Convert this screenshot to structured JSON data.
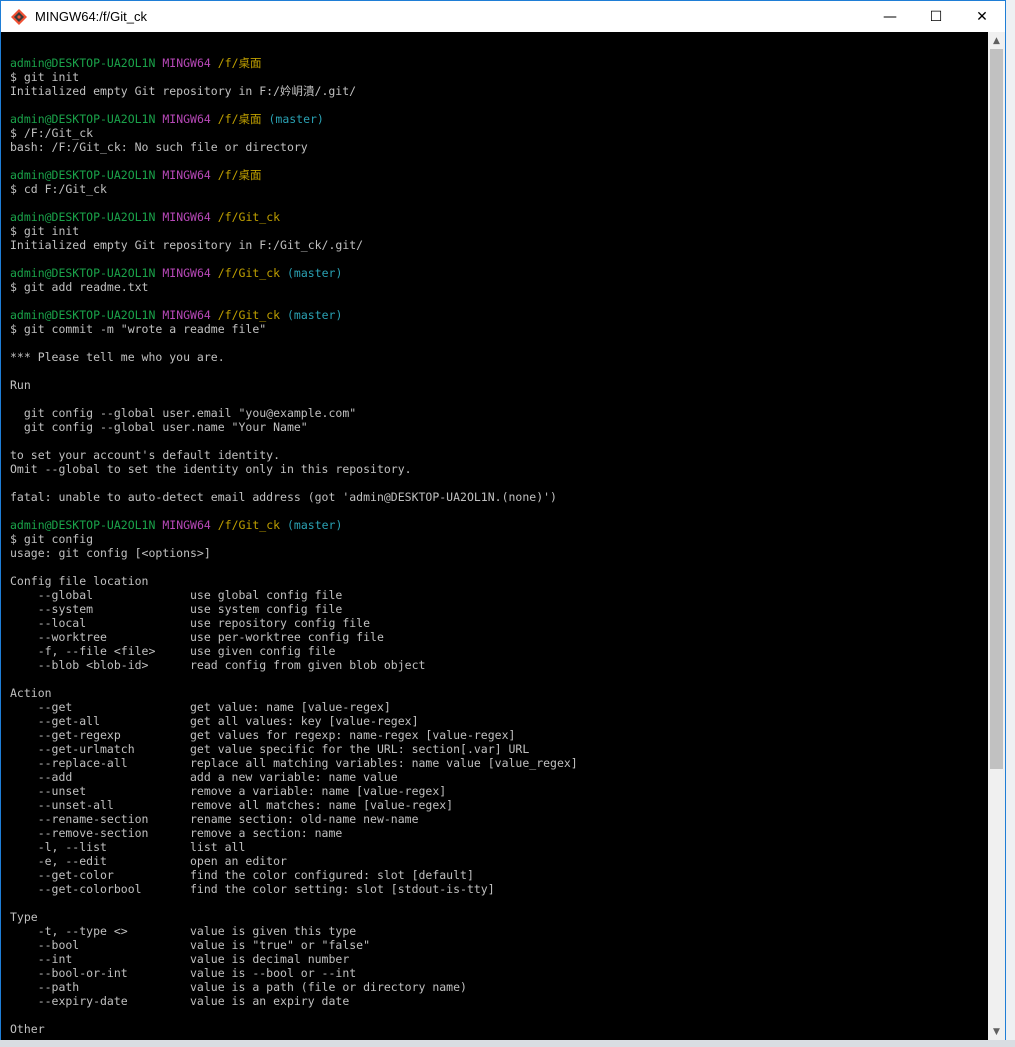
{
  "window": {
    "title": "MINGW64:/f/Git_ck",
    "buttons": {
      "minimize": "—",
      "maximize": "☐",
      "close": "✕"
    }
  },
  "colors": {
    "user": "#1aa34a",
    "mingw": "#b748b7",
    "path": "#c0a000",
    "branch": "#2aa1b3",
    "text": "#c0c0c0",
    "background": "#000000",
    "titlebar_border": "#1f7ed6"
  },
  "terminal": {
    "lines": [
      "",
      "admin@DESKTOP-UA2OL1N MINGW64 /f/桌面",
      "$ git init",
      "Initialized empty Git repository in F:/妗岄潰/.git/",
      "",
      "admin@DESKTOP-UA2OL1N MINGW64 /f/桌面 (master)",
      "$ /F:/Git_ck",
      "bash: /F:/Git_ck: No such file or directory",
      "",
      "admin@DESKTOP-UA2OL1N MINGW64 /f/桌面",
      "$ cd F:/Git_ck",
      "",
      "admin@DESKTOP-UA2OL1N MINGW64 /f/Git_ck",
      "$ git init",
      "Initialized empty Git repository in F:/Git_ck/.git/",
      "",
      "admin@DESKTOP-UA2OL1N MINGW64 /f/Git_ck (master)",
      "$ git add readme.txt",
      "",
      "admin@DESKTOP-UA2OL1N MINGW64 /f/Git_ck (master)",
      "$ git commit -m \"wrote a readme file\"",
      "",
      "*** Please tell me who you are.",
      "",
      "Run",
      "",
      "  git config --global user.email \"you@example.com\"",
      "  git config --global user.name \"Your Name\"",
      "",
      "to set your account's default identity.",
      "Omit --global to set the identity only in this repository.",
      "",
      "fatal: unable to auto-detect email address (got 'admin@DESKTOP-UA2OL1N.(none)')",
      "",
      "admin@DESKTOP-UA2OL1N MINGW64 /f/Git_ck (master)",
      "$ git config",
      "usage: git config [<options>]",
      "",
      "Config file location",
      "    --global              use global config file",
      "    --system              use system config file",
      "    --local               use repository config file",
      "    --worktree            use per-worktree config file",
      "    -f, --file <file>     use given config file",
      "    --blob <blob-id>      read config from given blob object",
      "",
      "Action",
      "    --get                 get value: name [value-regex]",
      "    --get-all             get all values: key [value-regex]",
      "    --get-regexp          get values for regexp: name-regex [value-regex]",
      "    --get-urlmatch        get value specific for the URL: section[.var] URL",
      "    --replace-all         replace all matching variables: name value [value_regex]",
      "    --add                 add a new variable: name value",
      "    --unset               remove a variable: name [value-regex]",
      "    --unset-all           remove all matches: name [value-regex]",
      "    --rename-section      rename section: old-name new-name",
      "    --remove-section      remove a section: name",
      "    -l, --list            list all",
      "    -e, --edit            open an editor",
      "    --get-color           find the color configured: slot [default]",
      "    --get-colorbool       find the color setting: slot [stdout-is-tty]",
      "",
      "Type",
      "    -t, --type <>         value is given this type",
      "    --bool                value is \"true\" or \"false\"",
      "    --int                 value is decimal number",
      "    --bool-or-int         value is --bool or --int",
      "    --path                value is a path (file or directory name)",
      "    --expiry-date         value is an expiry date",
      "",
      "Other"
    ]
  },
  "scrollbar": {
    "up": "▲",
    "down": "▼"
  }
}
